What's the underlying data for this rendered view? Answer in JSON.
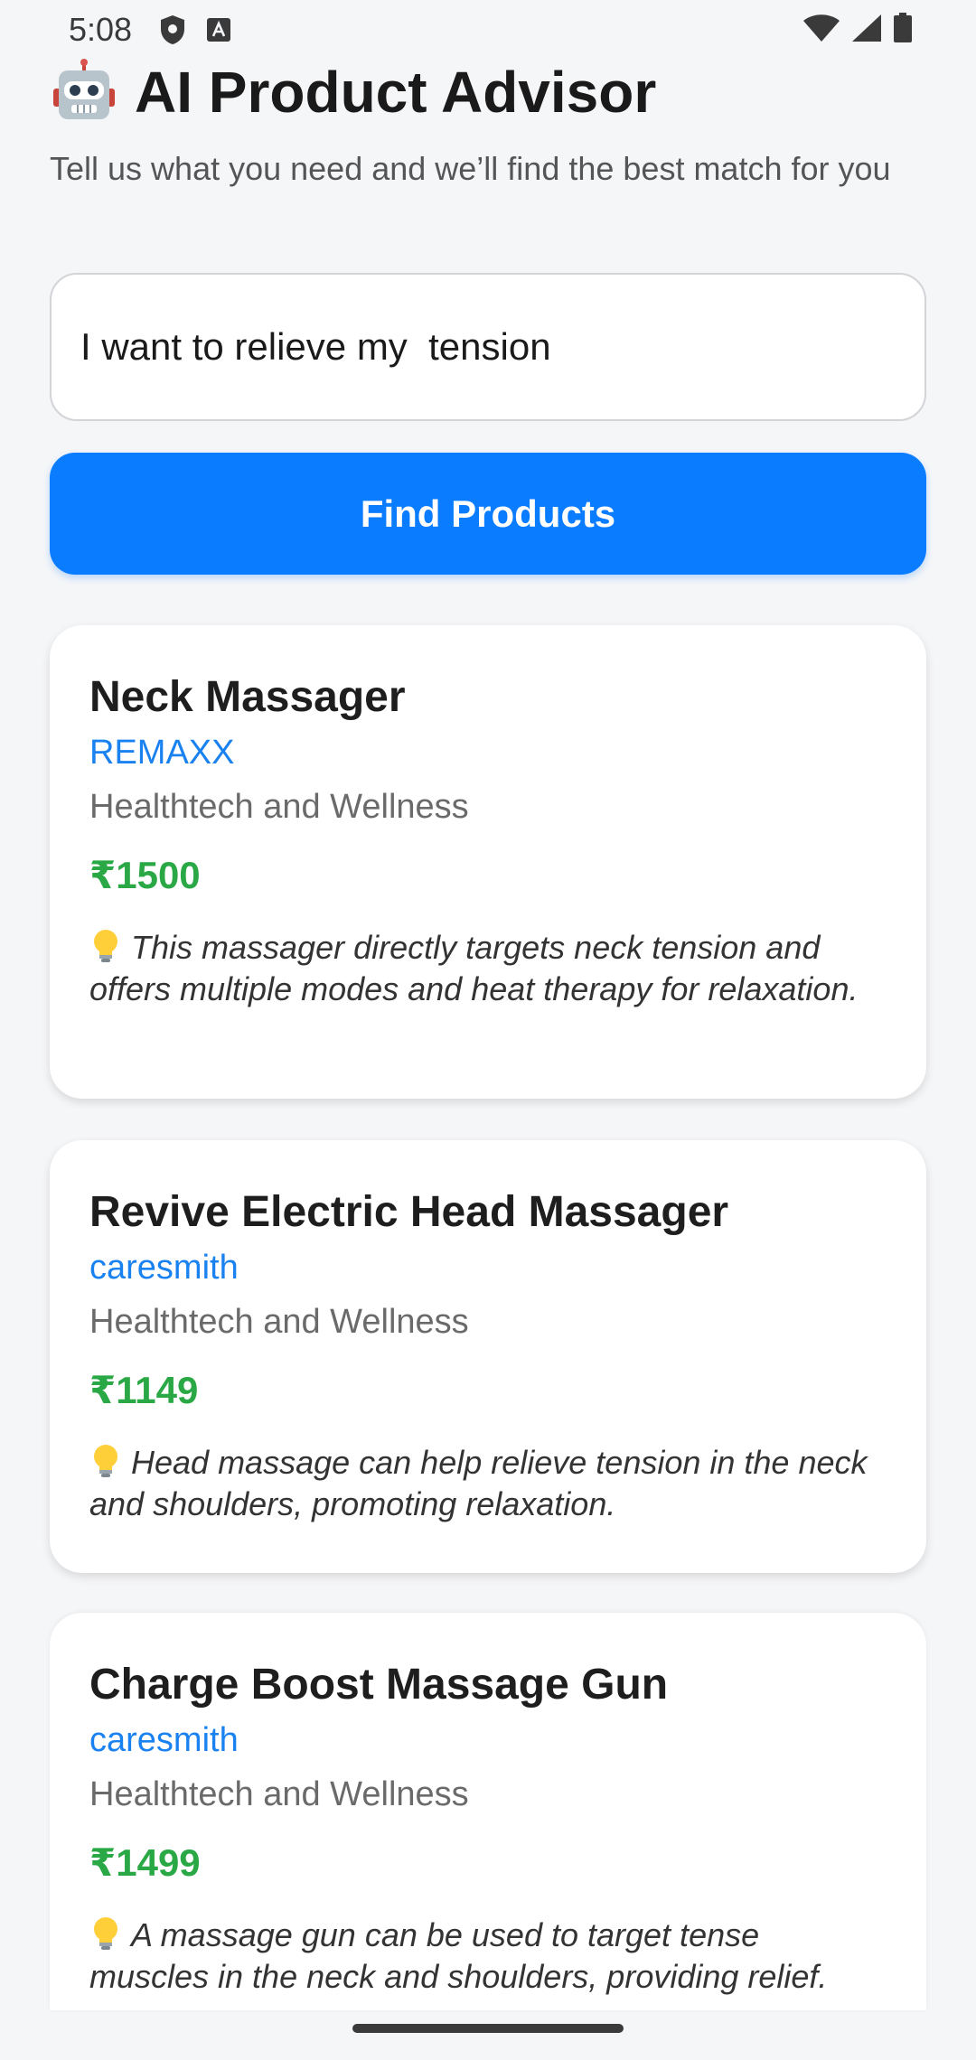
{
  "status_bar": {
    "time": "5:08"
  },
  "header": {
    "title": "AI Product Advisor",
    "subtitle": "Tell us what you need and we’ll find the best match for you"
  },
  "search": {
    "value": "I want to relieve my  tension",
    "button_label": "Find Products"
  },
  "products": [
    {
      "name": "Neck Massager",
      "brand": "REMAXX",
      "category": "Healthtech and Wellness",
      "price": "₹1500",
      "reason": "This massager directly targets neck tension and offers multiple modes and heat therapy for relaxation."
    },
    {
      "name": "Revive Electric Head Massager",
      "brand": "caresmith",
      "category": "Healthtech and Wellness",
      "price": "₹1149",
      "reason": "Head massage can help relieve tension in the neck and shoulders, promoting relaxation."
    },
    {
      "name": "Charge Boost Massage Gun",
      "brand": "caresmith",
      "category": "Healthtech and Wellness",
      "price": "₹1499",
      "reason": "A massage gun can be used to target tense muscles in the neck and shoulders, providing relief."
    }
  ],
  "icons": {
    "title": "robot-icon",
    "reason": "lightbulb-icon",
    "status": [
      "shield-icon",
      "keyboard-a-icon",
      "wifi-icon",
      "cellular-signal-icon",
      "battery-icon"
    ]
  },
  "colors": {
    "accent": "#0a7cff",
    "brand_link": "#1a82f0",
    "price": "#2aa845",
    "background": "#f5f6f8"
  }
}
